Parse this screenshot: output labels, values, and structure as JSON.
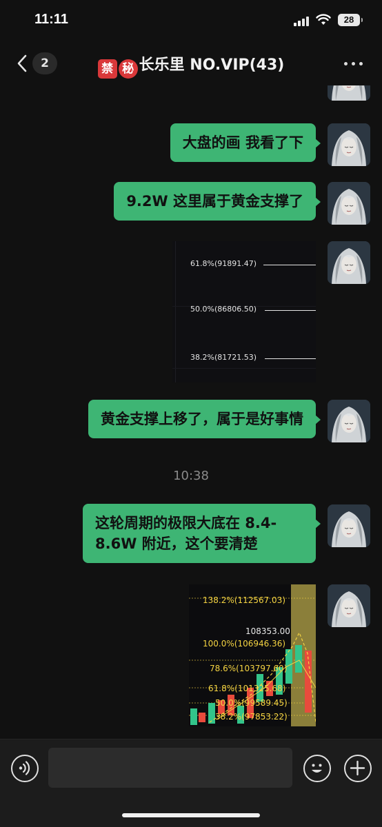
{
  "status_bar": {
    "time": "11:11",
    "battery": "28"
  },
  "nav": {
    "unread_count": "2",
    "title_emoji_1": "禁",
    "title_emoji_2": "秘",
    "title": "长乐里 NO.VIP(43)"
  },
  "messages": [
    {
      "type": "text",
      "text": "大盘的画 我看了下"
    },
    {
      "type": "text",
      "text": "9.2W 这里属于黄金支撑了"
    },
    {
      "type": "image",
      "fib_levels": [
        "61.8%(91891.47)",
        "50.0%(86806.50)",
        "38.2%(81721.53)"
      ]
    },
    {
      "type": "text",
      "text": "黄金支撑上移了，属于是好事情"
    },
    {
      "type": "timestamp",
      "text": "10:38"
    },
    {
      "type": "text",
      "text_line1": "这轮周期的极限大底在 8.4-",
      "text_line2": "8.6W 附近，这个要清楚"
    },
    {
      "type": "image",
      "price_label": "108353.00",
      "fib_levels": [
        "138.2%(112567.03)",
        "100.0%(106946.36)",
        "78.6%(103797.60)",
        "61.8%(101325.68)",
        "50.0%(99589.45)",
        "38.2%(97853.22)"
      ]
    }
  ],
  "colors": {
    "bubble": "#3eb574",
    "background": "#111111",
    "fib_yellow": "#f5d442"
  },
  "input": {
    "placeholder": ""
  }
}
